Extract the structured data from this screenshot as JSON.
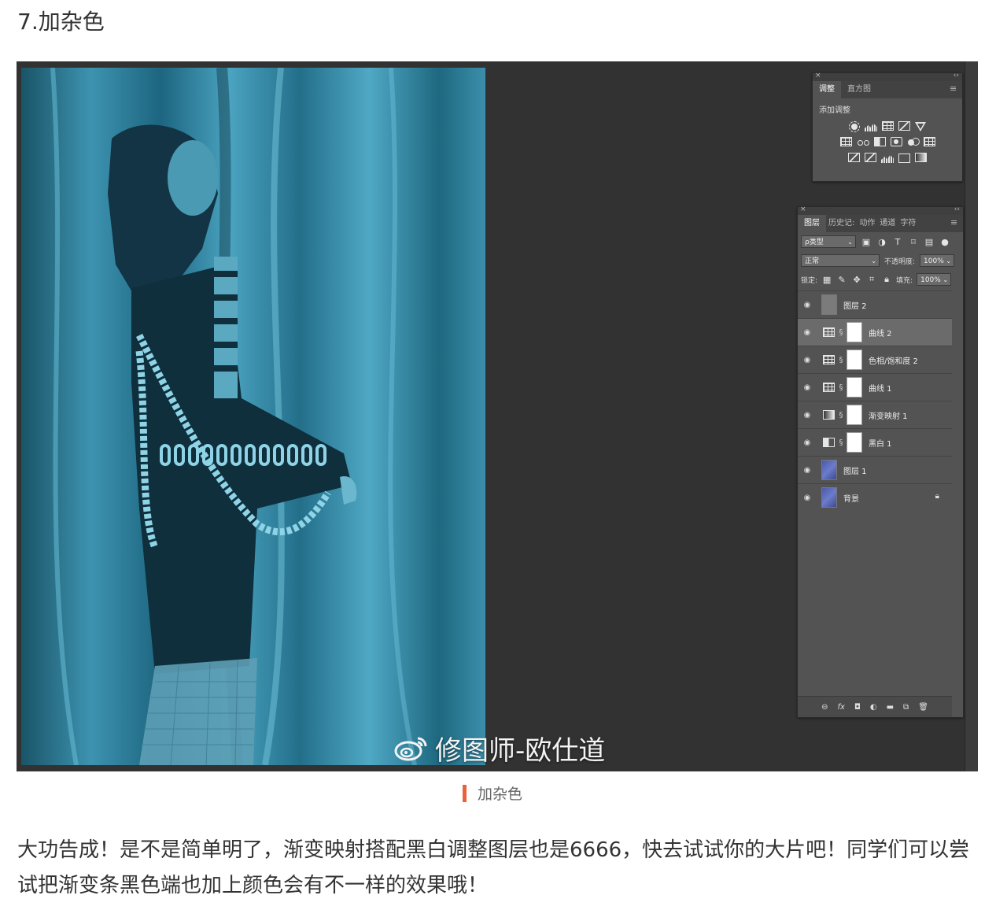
{
  "heading": "7.加杂色",
  "watermark": "修图师-欧仕道",
  "adjust_panel": {
    "tabs": [
      "调整",
      "直方图"
    ],
    "title": "添加调整"
  },
  "layers_panel": {
    "tabs": [
      "图层",
      "历史记:",
      "动作",
      "通道",
      "字符"
    ],
    "filter": "ρ类型",
    "blend_mode": "正常",
    "opacity_label": "不透明度:",
    "opacity_value": "100%",
    "lock_label": "锁定:",
    "fill_label": "填充:",
    "fill_value": "100%",
    "layers": [
      {
        "name": "图层 2",
        "kind": "gray"
      },
      {
        "name": "曲线 2",
        "kind": "curves",
        "selected": true
      },
      {
        "name": "色相/饱和度 2",
        "kind": "huesat"
      },
      {
        "name": "曲线 1",
        "kind": "curves"
      },
      {
        "name": "渐变映射 1",
        "kind": "gradient"
      },
      {
        "name": "黑白 1",
        "kind": "bw"
      },
      {
        "name": "图层 1",
        "kind": "image"
      },
      {
        "name": "背景",
        "kind": "image",
        "locked": true
      }
    ]
  },
  "caption": "加杂色",
  "paragraph": "大功告成！是不是简单明了，渐变映射搭配黑白调整图层也是6666，快去试试你的大片吧！同学们可以尝试把渐变条黑色端也加上颜色会有不一样的效果哦！"
}
